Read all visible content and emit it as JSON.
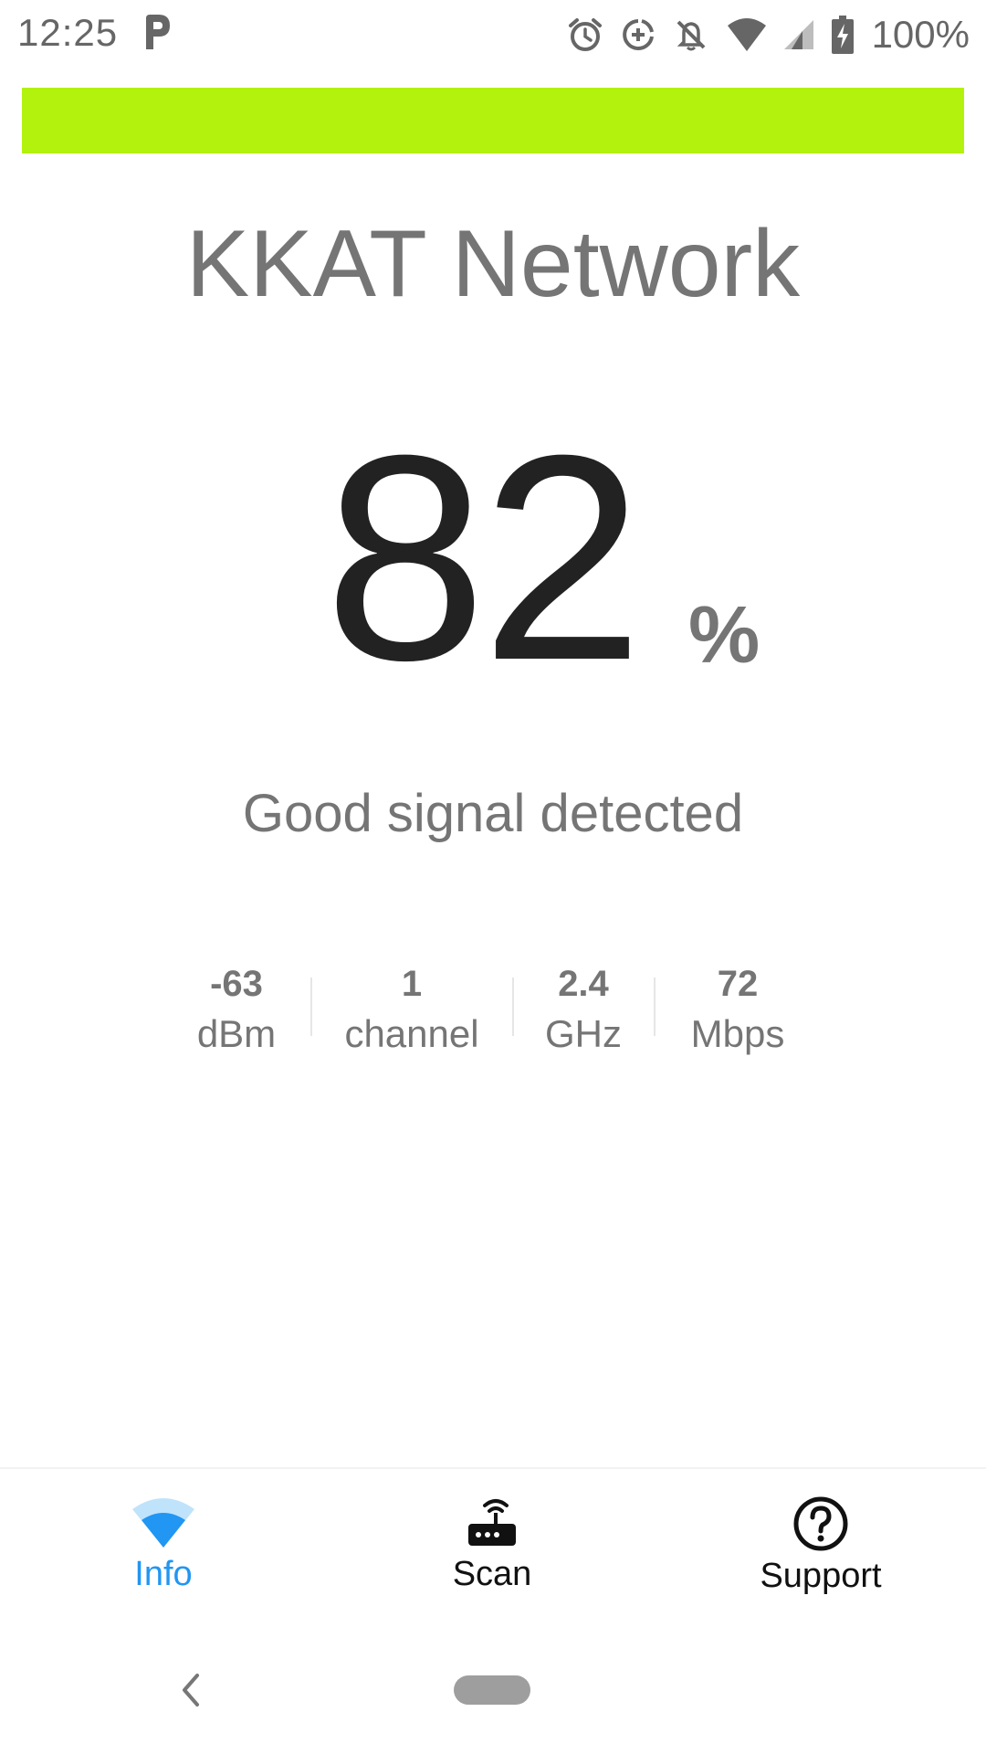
{
  "status_bar": {
    "time": "12:25",
    "battery": "100%",
    "icons": [
      "p-app-icon",
      "alarm-icon",
      "data-saver-icon",
      "notifications-off-icon",
      "wifi-icon",
      "cell-signal-icon",
      "battery-charging-icon"
    ]
  },
  "signal_bar": {
    "fill_percent": 100,
    "color": "#b3f20d"
  },
  "network": {
    "name": "KKAT Network"
  },
  "signal": {
    "value": "82",
    "unit": "%",
    "status": "Good signal detected"
  },
  "stats": [
    {
      "value": "-63",
      "unit": "dBm"
    },
    {
      "value": "1",
      "unit": "channel"
    },
    {
      "value": "2.4",
      "unit": "GHz"
    },
    {
      "value": "72",
      "unit": "Mbps"
    }
  ],
  "bottom_nav": {
    "active_color": "#2196f3",
    "items": [
      {
        "label": "Info",
        "icon": "wifi-icon",
        "active": true
      },
      {
        "label": "Scan",
        "icon": "router-icon",
        "active": false
      },
      {
        "label": "Support",
        "icon": "help-circle-icon",
        "active": false
      }
    ]
  }
}
